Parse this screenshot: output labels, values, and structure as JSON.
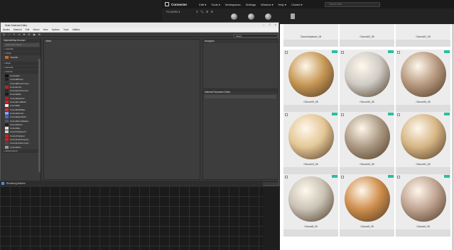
{
  "topbar": {
    "app_name": "Connecter",
    "menus": [
      "Edit ▾",
      "Tools ▾",
      "Workspaces",
      "Settings",
      "Window ▾",
      "Help ▾",
      "Cloned ▾"
    ],
    "search_placeholder": "Search files"
  },
  "toolbar2": {
    "folders_label": "FOLDERS ▾"
  },
  "editor": {
    "title": "Slate Material Editor",
    "menu": [
      "Modes",
      "Material",
      "Edit",
      "Select",
      "View",
      "Options",
      "Tools",
      "Utilities"
    ],
    "view_select": "View1",
    "browser": {
      "header": "Material/Map Browser",
      "search_placeholder": "Search by Name ...",
      "groups": [
        "+ Controls",
        "+ V-Ray",
        "+ Maps",
        "+ General",
        "+ Corona",
        "+ Environment"
      ],
      "vray_items": [
        "VRayMtl"
      ],
      "corona_items": [
        {
          "label": "CoronaAO",
          "color": "#111111"
        },
        {
          "label": "CoronaBitmap",
          "color": "#222222"
        },
        {
          "label": "CoronaBumpConver...",
          "color": "#333333"
        },
        {
          "label": "CoronaColor",
          "color": "#bb2222"
        },
        {
          "label": "CoronaColorCorrect",
          "color": "#2a2a2a"
        },
        {
          "label": "CoronaData",
          "color": "#1a1a1a"
        },
        {
          "label": "CoronaDistance",
          "color": "#cc1111"
        },
        {
          "label": "CoronaFrontBack",
          "color": "#d62020"
        },
        {
          "label": "CoronaMix",
          "color": "#eeeeee"
        },
        {
          "label": "CoronaMultiMap",
          "color": "#c93030"
        },
        {
          "label": "CoronaNormal",
          "color": "#8aa0ff"
        },
        {
          "label": "CoronaRaySwitch",
          "color": "#3a6fd0"
        },
        {
          "label": "CoronaRoundEdges",
          "color": "#555555"
        },
        {
          "label": "CoronaSelect",
          "color": "#222222"
        },
        {
          "label": "CoronaSky",
          "color": "#e0e0e0"
        },
        {
          "label": "CoronaTriplanarT...",
          "color": "#cfcfcf"
        },
        {
          "label": "CoronaTriplanar",
          "color": "#d41c1c"
        },
        {
          "label": "CoronaUserProperty",
          "color": "#cc2222"
        },
        {
          "label": "CoronaUnitsConvert...",
          "color": "#4a4a4a"
        },
        {
          "label": "CoronaWire",
          "color": "#9a9a9a"
        }
      ]
    },
    "smart_view_label": "View1",
    "navigator_label": "Navigator",
    "mpe_label": "Material Parameter Editor",
    "zoom": "60% ▾"
  },
  "render_status": "Rendering finished",
  "materials": {
    "rows": [
      [
        "Clwood/replacer_08",
        "Clwood22_08",
        "Clwood21_08"
      ],
      [
        "Clwood19_08",
        "Clwood16_08",
        "Clwood16_08"
      ],
      [
        "Clwood13_08",
        "Clwood10_08",
        "Clwood11_08"
      ],
      [
        "Clwood8_08",
        "Clwood5_08",
        "Clwood4_08"
      ]
    ],
    "colors": [
      [
        "#c79855",
        "#cfcbc5",
        "#b89a80"
      ],
      [
        "#e4c796",
        "#ad9a84",
        "#d6b585"
      ],
      [
        "#c9c2b5",
        "#cf8e4d",
        "#c0a491"
      ]
    ]
  }
}
